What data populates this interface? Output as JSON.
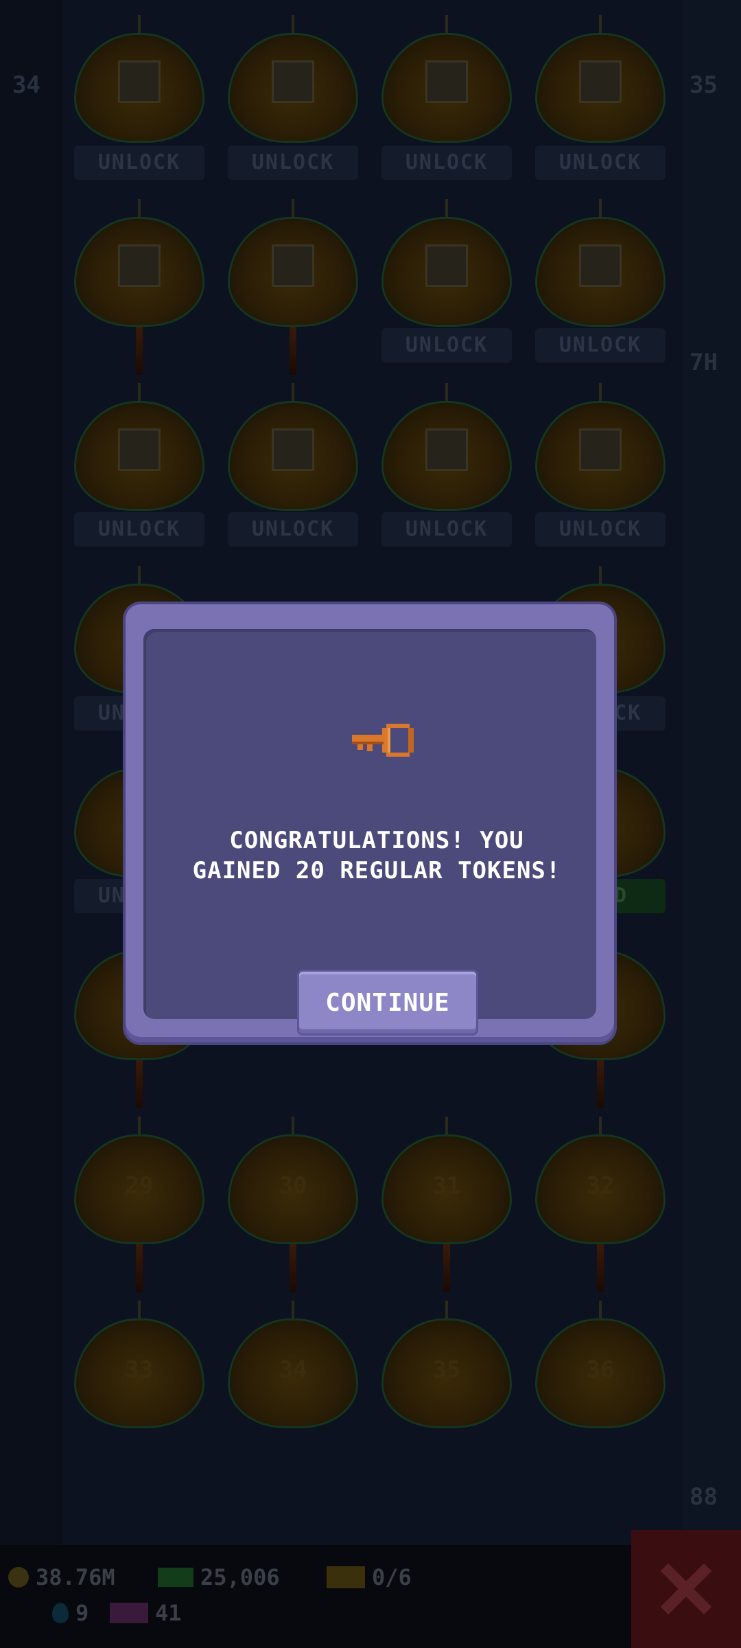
{
  "background": {
    "lantern_numbers": [
      "29",
      "30",
      "31",
      "32",
      "33",
      "34",
      "35",
      "36"
    ],
    "unlock_label": "UNLOCK",
    "ad_label": "N AD",
    "side_left_top": "34",
    "side_right_top": "35",
    "side_right_mid": "7H",
    "side_right_bottom": "88",
    "status": {
      "coins": "38.76M",
      "cash": "25,006",
      "tickets": "0/6",
      "gems": "9",
      "tokens": "41"
    }
  },
  "dialog": {
    "message": "CONGRATULATIONS! YOU\nGAINED 20 REGULAR TOKENS!",
    "continue_label": "CONTINUE",
    "icon": "key-icon",
    "colors": {
      "frame": "#7a72b2",
      "panel": "#4b4a7a",
      "button": "#8d87c7",
      "key": "#d9782a"
    }
  }
}
